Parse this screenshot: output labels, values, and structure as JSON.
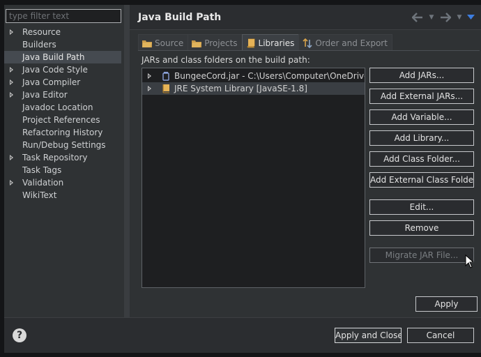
{
  "filter": {
    "placeholder": "type filter text"
  },
  "sidebar": {
    "items": [
      {
        "label": "Resource",
        "expandable": true,
        "selected": false
      },
      {
        "label": "Builders",
        "expandable": false,
        "selected": false
      },
      {
        "label": "Java Build Path",
        "expandable": false,
        "selected": true
      },
      {
        "label": "Java Code Style",
        "expandable": true,
        "selected": false
      },
      {
        "label": "Java Compiler",
        "expandable": true,
        "selected": false
      },
      {
        "label": "Java Editor",
        "expandable": true,
        "selected": false
      },
      {
        "label": "Javadoc Location",
        "expandable": false,
        "selected": false
      },
      {
        "label": "Project References",
        "expandable": false,
        "selected": false
      },
      {
        "label": "Refactoring History",
        "expandable": false,
        "selected": false
      },
      {
        "label": "Run/Debug Settings",
        "expandable": false,
        "selected": false
      },
      {
        "label": "Task Repository",
        "expandable": true,
        "selected": false
      },
      {
        "label": "Task Tags",
        "expandable": false,
        "selected": false
      },
      {
        "label": "Validation",
        "expandable": true,
        "selected": false
      },
      {
        "label": "WikiText",
        "expandable": false,
        "selected": false
      }
    ]
  },
  "header": {
    "title": "Java Build Path"
  },
  "tabs": [
    {
      "label": "Source",
      "icon": "source-folder-icon",
      "active": false
    },
    {
      "label": "Projects",
      "icon": "projects-folder-icon",
      "active": false
    },
    {
      "label": "Libraries",
      "icon": "library-books-icon",
      "active": true
    },
    {
      "label": "Order and Export",
      "icon": "order-export-icon",
      "active": false
    }
  ],
  "libraries": {
    "section_label": "JARs and class folders on the build path:",
    "entries": [
      {
        "label": "BungeeCord.jar - C:\\Users\\Computer\\OneDrive\\Jar",
        "icon": "jar-file-icon",
        "selected": false
      },
      {
        "label": "JRE System Library [JavaSE-1.8]",
        "icon": "library-icon",
        "selected": true
      }
    ]
  },
  "buttons": {
    "add_jars": "Add JARs...",
    "add_external_jars": "Add External JARs...",
    "add_variable": "Add Variable...",
    "add_library": "Add Library...",
    "add_class_folder": "Add Class Folder...",
    "add_external_class_folder": "Add External Class Folder...",
    "edit": "Edit...",
    "remove": "Remove",
    "migrate_jar": "Migrate JAR File...",
    "apply": "Apply",
    "apply_and_close": "Apply and Close",
    "cancel": "Cancel"
  },
  "colors": {
    "background": "#2f3234",
    "list_background": "#1e1f21",
    "selection": "#454a50",
    "accent_blue": "#3d7de0"
  }
}
